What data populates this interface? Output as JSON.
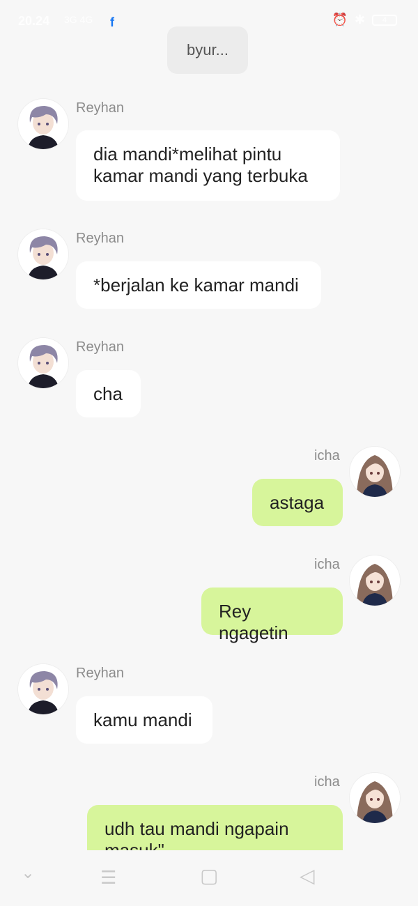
{
  "status": {
    "time": "20.24",
    "signal": "3G 4G",
    "fb": "f",
    "battery": "4"
  },
  "system_message": "byur...",
  "messages": [
    {
      "side": "left",
      "name": "Reyhan",
      "text": "dia mandi*melihat pintu\nkamar mandi yang terbuka"
    },
    {
      "side": "left",
      "name": "Reyhan",
      "text": "*berjalan ke kamar mandi"
    },
    {
      "side": "left",
      "name": "Reyhan",
      "text": "cha"
    },
    {
      "side": "right",
      "name": "icha",
      "text": "astaga"
    },
    {
      "side": "right",
      "name": "icha",
      "text": "Rey ngagetin"
    },
    {
      "side": "left",
      "name": "Reyhan",
      "text": "kamu mandi"
    },
    {
      "side": "right",
      "name": "icha",
      "text": "udh tau mandi ngapain\nmasuk\""
    }
  ],
  "nav": {
    "down": "⌄",
    "menu": "☰",
    "home": "▢",
    "back": "◁"
  },
  "colors": {
    "left_bubble": "#ffffff",
    "right_bubble": "#d7f59b",
    "background": "#f7f7f7"
  }
}
